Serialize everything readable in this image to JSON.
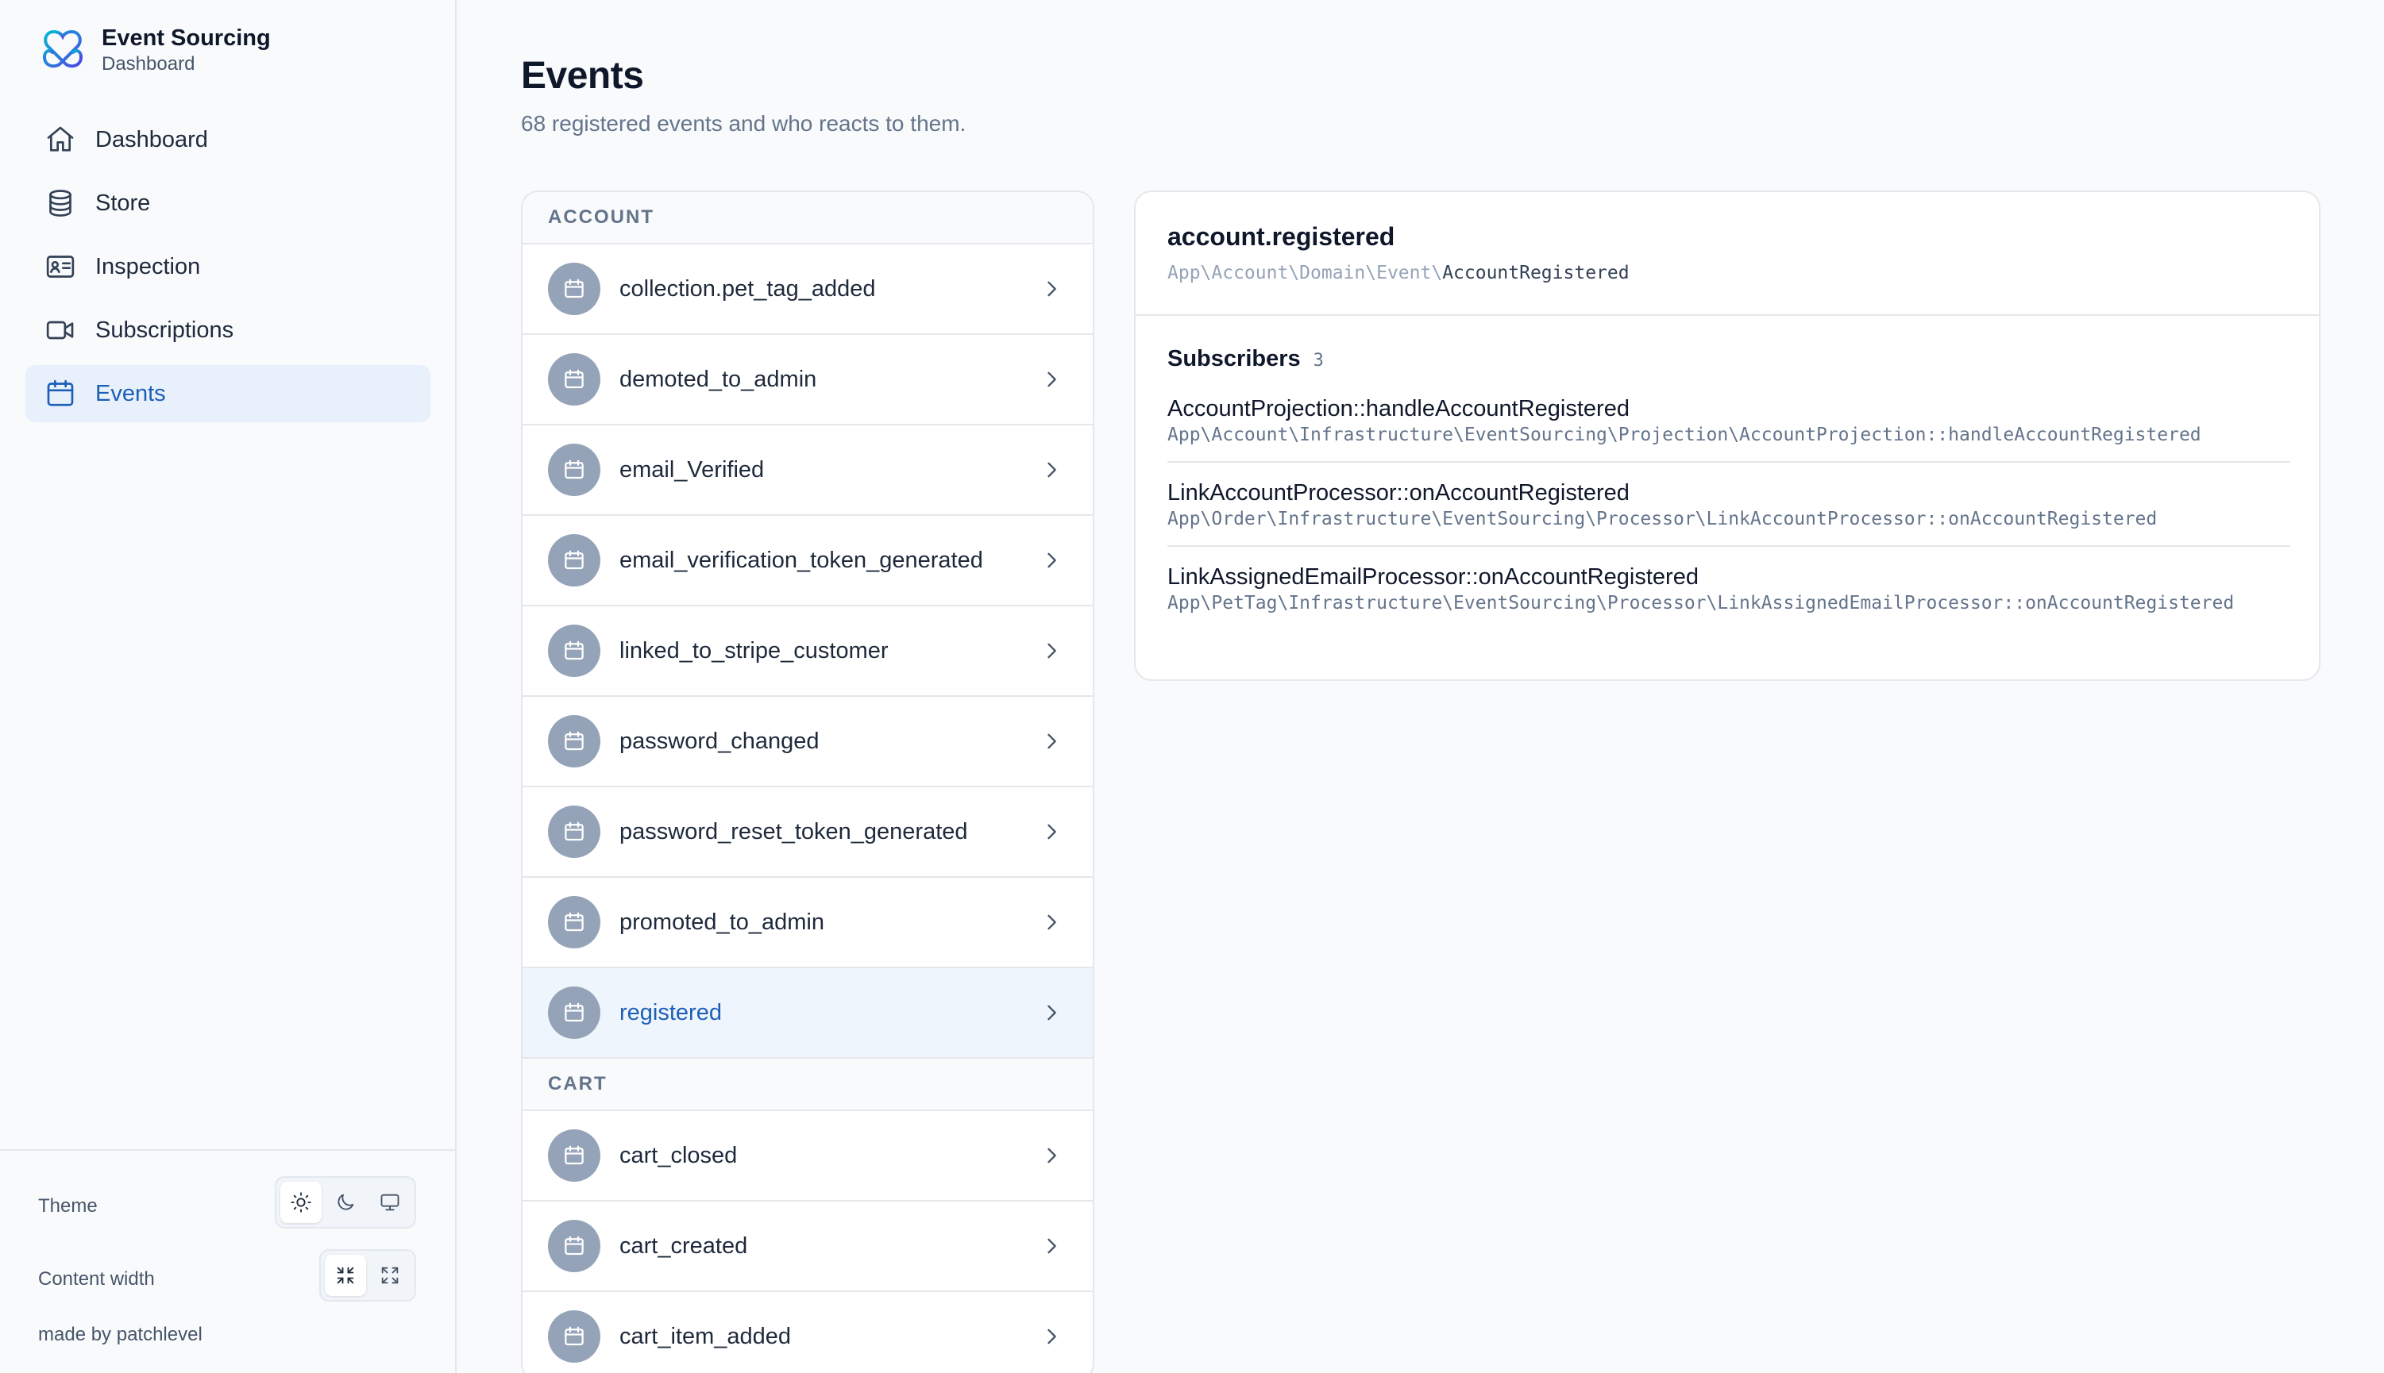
{
  "app": {
    "title": "Event Sourcing",
    "subtitle": "Dashboard",
    "logo_icon": "logo-knot-icon",
    "accent_color": "#1d5fb8"
  },
  "sidebar": {
    "items": [
      {
        "label": "Dashboard",
        "icon": "home-icon",
        "active": false
      },
      {
        "label": "Store",
        "icon": "database-icon",
        "active": false
      },
      {
        "label": "Inspection",
        "icon": "id-card-icon",
        "active": false
      },
      {
        "label": "Subscriptions",
        "icon": "video-icon",
        "active": false
      },
      {
        "label": "Events",
        "icon": "calendar-icon",
        "active": true
      }
    ],
    "footer": {
      "theme_label": "Theme",
      "theme_options": [
        "light",
        "dark",
        "system"
      ],
      "theme_selected": "light",
      "content_width_label": "Content width",
      "content_width_options": [
        "compact",
        "full"
      ],
      "content_width_selected": "compact",
      "made_by": "made by patchlevel"
    }
  },
  "main": {
    "title": "Events",
    "subtitle": "68 registered events and who reacts to them.",
    "groups": [
      {
        "name": "ACCOUNT",
        "events": [
          {
            "name": "collection.pet_tag_added",
            "selected": false
          },
          {
            "name": "demoted_to_admin",
            "selected": false
          },
          {
            "name": "email_Verified",
            "selected": false
          },
          {
            "name": "email_verification_token_generated",
            "selected": false
          },
          {
            "name": "linked_to_stripe_customer",
            "selected": false
          },
          {
            "name": "password_changed",
            "selected": false
          },
          {
            "name": "password_reset_token_generated",
            "selected": false
          },
          {
            "name": "promoted_to_admin",
            "selected": false
          },
          {
            "name": "registered",
            "selected": true
          }
        ]
      },
      {
        "name": "CART",
        "events": [
          {
            "name": "cart_closed",
            "selected": false
          },
          {
            "name": "cart_created",
            "selected": false
          },
          {
            "name": "cart_item_added",
            "selected": false
          }
        ]
      }
    ],
    "detail": {
      "title": "account.registered",
      "class_namespace": "App\\Account\\Domain\\Event\\",
      "class_name": "AccountRegistered",
      "subscribers_label": "Subscribers",
      "subscribers_count": "3",
      "subscribers": [
        {
          "name": "AccountProjection::handleAccountRegistered",
          "path": "App\\Account\\Infrastructure\\EventSourcing\\Projection\\AccountProjection::handleAccountRegistered"
        },
        {
          "name": "LinkAccountProcessor::onAccountRegistered",
          "path": "App\\Order\\Infrastructure\\EventSourcing\\Processor\\LinkAccountProcessor::onAccountRegistered"
        },
        {
          "name": "LinkAssignedEmailProcessor::onAccountRegistered",
          "path": "App\\PetTag\\Infrastructure\\EventSourcing\\Processor\\LinkAssignedEmailProcessor::onAccountRegistered"
        }
      ]
    }
  }
}
